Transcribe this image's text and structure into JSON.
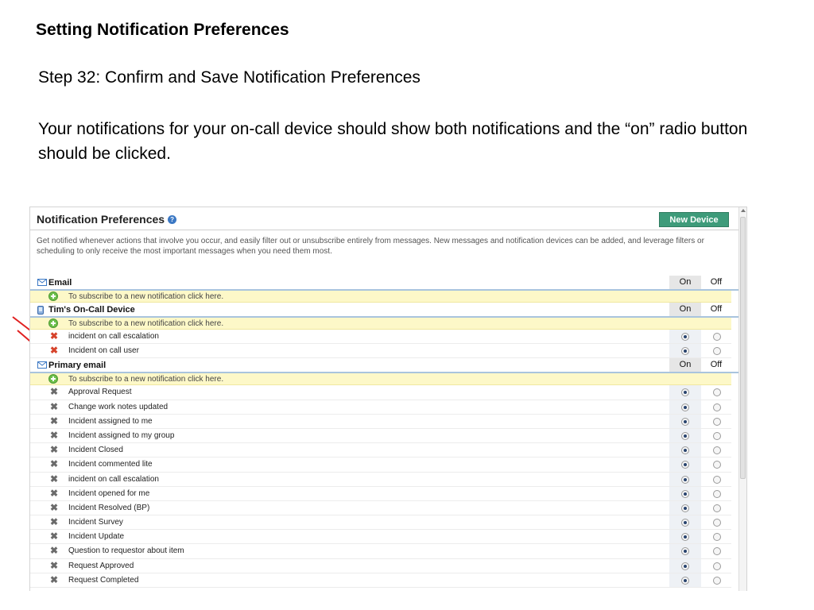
{
  "slide": {
    "title": "Setting Notification Preferences",
    "step": "Step 32: Confirm and Save Notification Preferences",
    "description": "Your notifications for your on-call device should show both notifications and the “on” radio button should be clicked."
  },
  "panel": {
    "title": "Notification Preferences",
    "help_icon": "help-icon",
    "new_device_label": "New Device",
    "description": "Get notified whenever actions that involve you occur, and easily filter out or unsubscribe entirely from messages. New messages and notification devices can be added, and leverage filters or scheduling to only receive the most important messages when you need them most.",
    "col_on": "On",
    "col_off": "Off",
    "subscribe_text": "To subscribe to a new notification click here."
  },
  "sections": [
    {
      "key": "email",
      "label": "Email",
      "icon": "envelope-icon",
      "items": []
    },
    {
      "key": "oncall",
      "label": "Tim's On-Call Device",
      "icon": "mobile-device-icon",
      "items": [
        {
          "label": "incident on call escalation",
          "on": true,
          "icon_color": "#d6432b"
        },
        {
          "label": "Incident on call user",
          "on": true,
          "icon_color": "#d6432b"
        }
      ]
    },
    {
      "key": "primary",
      "label": "Primary email",
      "icon": "envelope-icon",
      "items": [
        {
          "label": "Approval Request",
          "on": true
        },
        {
          "label": "Change work notes updated",
          "on": true
        },
        {
          "label": "Incident assigned to me",
          "on": true
        },
        {
          "label": "Incident assigned to my group",
          "on": true
        },
        {
          "label": "Incident Closed",
          "on": true
        },
        {
          "label": "Incident commented lite",
          "on": true
        },
        {
          "label": "incident on call escalation",
          "on": true
        },
        {
          "label": "Incident opened for me",
          "on": true
        },
        {
          "label": "Incident Resolved (BP)",
          "on": true
        },
        {
          "label": "Incident Survey",
          "on": true
        },
        {
          "label": "Incident Update",
          "on": true
        },
        {
          "label": "Question to requestor about item",
          "on": true
        },
        {
          "label": "Request Approved",
          "on": true
        },
        {
          "label": "Request Completed",
          "on": true
        }
      ]
    }
  ],
  "colors": {
    "accent_button": "#3e9b7a",
    "subscribe_bg": "#fdf8c8",
    "arrow": "#e02020",
    "section_rule": "#a9c4dd"
  }
}
